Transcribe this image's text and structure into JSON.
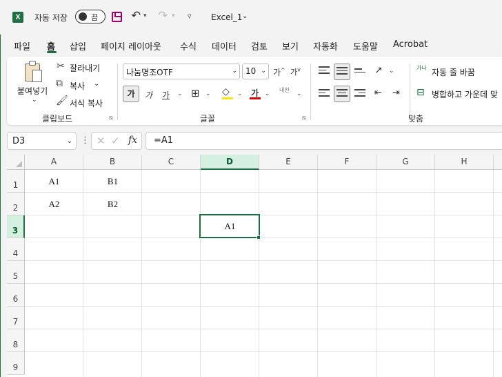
{
  "titlebar": {
    "app_icon": "excel-logo-icon",
    "app_letter": "X",
    "autosave_label": "자동 저장",
    "autosave_state": "끔",
    "doc_title": "Excel_1",
    "qa_more": "▿"
  },
  "tabs": [
    "파일",
    "홈",
    "삽입",
    "페이지 레이아웃",
    "수식",
    "데이터",
    "검토",
    "보기",
    "자동화",
    "도움말",
    "Acrobat"
  ],
  "active_tab": "홈",
  "ribbon": {
    "clipboard": {
      "group_label": "클립보드",
      "paste_label": "붙여넣기",
      "cut_label": "잘라내기",
      "copy_label": "복사",
      "format_painter_label": "서식 복사"
    },
    "font": {
      "group_label": "글꼴",
      "font_name": "나눔명조OTF",
      "font_size": "10",
      "grow_label": "가",
      "shrink_label": "가",
      "bold_label": "가",
      "italic_label": "가",
      "underline_label": "가",
      "font_color_label": "가",
      "phonetic_label": "내천",
      "highlight_color": "#ffe600",
      "font_color": "#e00000"
    },
    "alignment": {
      "group_label": "맞춤",
      "wrap_label": "자동 줄 바꿈",
      "merge_label": "병합하고 가운데 맞",
      "wrap_icon_label": "가나"
    }
  },
  "formula_bar": {
    "name_box": "D3",
    "fx_label": "fx",
    "formula": "=A1"
  },
  "grid": {
    "columns": [
      "A",
      "B",
      "C",
      "D",
      "E",
      "F",
      "G",
      "H"
    ],
    "rows": [
      "1",
      "2",
      "3",
      "4",
      "5",
      "6",
      "7",
      "8",
      "9"
    ],
    "selected_column": "D",
    "selected_row": "3",
    "cells": {
      "A1": "A1",
      "B1": "B1",
      "A2": "A2",
      "B2": "B2",
      "D3": "A1"
    }
  },
  "colors": {
    "accent": "#1d6f42",
    "save_icon": "#a4006b"
  }
}
